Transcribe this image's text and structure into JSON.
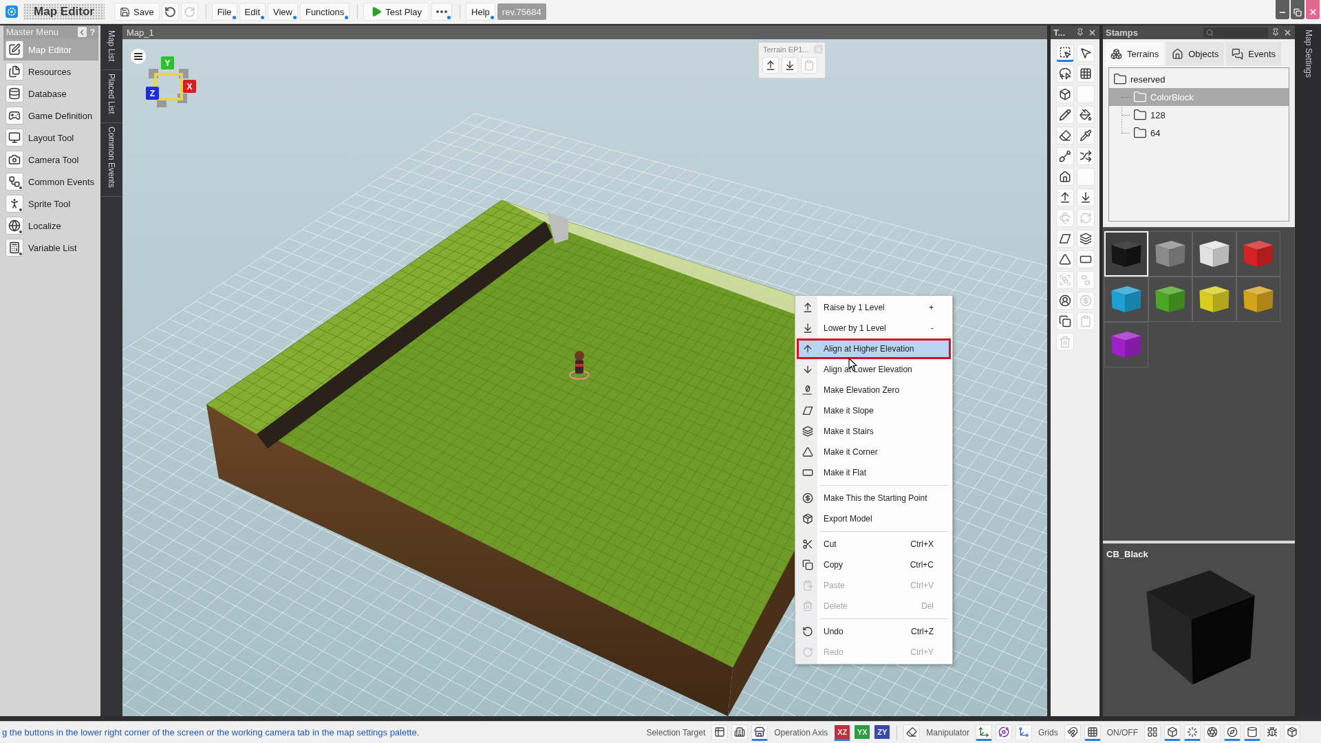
{
  "title_bar": {
    "app_title": "Map Editor",
    "save": "Save",
    "undo": {
      "disabled": false
    },
    "redo": {
      "disabled": true
    },
    "menus": [
      {
        "label": "File"
      },
      {
        "label": "Edit"
      },
      {
        "label": "View"
      },
      {
        "label": "Functions"
      }
    ],
    "test_play": "Test Play",
    "help": "Help",
    "revision": "rev.75684"
  },
  "master_menu": {
    "title": "Master Menu",
    "help_mark": "?",
    "items": [
      {
        "label": "Map Editor",
        "kind": "map-editor",
        "selected": true,
        "submenu": false
      },
      {
        "label": "Resources",
        "kind": "resources",
        "selected": false,
        "submenu": false
      },
      {
        "label": "Database",
        "kind": "database",
        "selected": false,
        "submenu": false
      },
      {
        "label": "Game Definition",
        "kind": "game-definition",
        "selected": false,
        "submenu": false
      },
      {
        "label": "Layout Tool",
        "kind": "layout-tool",
        "selected": false,
        "submenu": false
      },
      {
        "label": "Camera Tool",
        "kind": "camera-tool",
        "selected": false,
        "submenu": false
      },
      {
        "label": "Common Events",
        "kind": "common-events",
        "selected": false,
        "submenu": true
      },
      {
        "label": "Sprite Tool",
        "kind": "sprite-tool",
        "selected": false,
        "submenu": true
      },
      {
        "label": "Localize",
        "kind": "localize",
        "selected": false,
        "submenu": true
      },
      {
        "label": "Variable List",
        "kind": "variable-list",
        "selected": false,
        "submenu": true
      }
    ]
  },
  "side_tabs": [
    {
      "label": "Map List"
    },
    {
      "label": "Placed List"
    },
    {
      "label": "Common Events"
    }
  ],
  "map_view": {
    "title": "Map_1",
    "axes": [
      {
        "label": "Y",
        "color": "#2ec02e"
      },
      {
        "label": "X",
        "color": "#d61f1f"
      },
      {
        "label": "Z",
        "color": "#1f2fd6"
      }
    ],
    "terrain_popup": {
      "title": "Terrain EP1...",
      "buttons": [
        {
          "kind": "raise",
          "disabled": false
        },
        {
          "kind": "lower",
          "disabled": false
        },
        {
          "kind": "clipboard",
          "disabled": true
        }
      ]
    }
  },
  "context_menu": {
    "sections": [
      [
        {
          "label": "Raise by 1 Level",
          "shortcut": "+",
          "kind": "raise",
          "selected": false,
          "disabled": false
        },
        {
          "label": "Lower by 1 Level",
          "shortcut": "-",
          "kind": "lower",
          "selected": false,
          "disabled": false
        },
        {
          "label": "Align at Higher Elevation",
          "kind": "align-up",
          "selected": true,
          "disabled": false
        },
        {
          "label": "Align at Lower Elevation",
          "kind": "align-down",
          "selected": false,
          "disabled": false
        },
        {
          "label": "Make Elevation Zero",
          "kind": "zero",
          "selected": false,
          "disabled": false
        },
        {
          "label": "Make it Slope",
          "kind": "slope",
          "selected": false,
          "disabled": false
        },
        {
          "label": "Make it Stairs",
          "kind": "stairs",
          "selected": false,
          "disabled": false
        },
        {
          "label": "Make it Corner",
          "kind": "corner",
          "selected": false,
          "disabled": false
        },
        {
          "label": "Make it Flat",
          "kind": "flat",
          "selected": false,
          "disabled": false
        }
      ],
      [
        {
          "label": "Make This the Starting Point",
          "kind": "start-point",
          "selected": false,
          "disabled": false
        },
        {
          "label": "Export Model",
          "kind": "export",
          "selected": false,
          "disabled": false
        }
      ],
      [
        {
          "label": "Cut",
          "shortcut": "Ctrl+X",
          "kind": "cut",
          "selected": false,
          "disabled": false
        },
        {
          "label": "Copy",
          "shortcut": "Ctrl+C",
          "kind": "copy",
          "selected": false,
          "disabled": false
        },
        {
          "label": "Paste",
          "shortcut": "Ctrl+V",
          "kind": "paste",
          "selected": false,
          "disabled": true
        },
        {
          "label": "Delete",
          "shortcut": "Del",
          "kind": "trash",
          "selected": false,
          "disabled": true
        }
      ],
      [
        {
          "label": "Undo",
          "shortcut": "Ctrl+Z",
          "kind": "undo",
          "selected": false,
          "disabled": false
        },
        {
          "label": "Redo",
          "shortcut": "Ctrl+Y",
          "kind": "redo",
          "selected": false,
          "disabled": true
        }
      ]
    ]
  },
  "tool_palette": {
    "title": "T...",
    "tools": [
      {
        "kind": "dashed-select",
        "selected": true,
        "disabled": false
      },
      {
        "kind": "pointer",
        "selected": false,
        "disabled": false
      },
      {
        "kind": "lasso",
        "selected": false,
        "disabled": false
      },
      {
        "kind": "grid-select",
        "selected": false,
        "disabled": false
      },
      {
        "kind": "cube-select",
        "selected": false,
        "disabled": false
      },
      {
        "kind": "blank",
        "selected": false
      },
      {
        "kind": "pencil",
        "selected": false,
        "disabled": false
      },
      {
        "kind": "paint-bucket",
        "selected": false,
        "disabled": false
      },
      {
        "kind": "eraser",
        "selected": false,
        "disabled": false
      },
      {
        "kind": "pipette",
        "selected": false,
        "disabled": false
      },
      {
        "kind": "shovel",
        "selected": false,
        "disabled": false
      },
      {
        "kind": "shuffle",
        "selected": false,
        "disabled": false
      },
      {
        "kind": "house",
        "selected": false,
        "disabled": false
      },
      {
        "kind": "blank",
        "selected": false
      },
      {
        "kind": "raise",
        "selected": false,
        "disabled": false
      },
      {
        "kind": "lower",
        "selected": false,
        "disabled": false
      },
      {
        "kind": "rotate",
        "selected": false,
        "disabled": true
      },
      {
        "kind": "rotate-flip",
        "selected": false,
        "disabled": true
      },
      {
        "kind": "slope",
        "selected": false,
        "disabled": false
      },
      {
        "kind": "stairs",
        "selected": false,
        "disabled": false
      },
      {
        "kind": "corner",
        "selected": false,
        "disabled": false
      },
      {
        "kind": "flat",
        "selected": false,
        "disabled": false
      },
      {
        "kind": "group",
        "selected": false,
        "disabled": true
      },
      {
        "kind": "ungroup",
        "selected": false,
        "disabled": true
      },
      {
        "kind": "person-spot",
        "selected": false,
        "disabled": false
      },
      {
        "kind": "start-point",
        "selected": false,
        "disabled": true
      },
      {
        "kind": "copy",
        "selected": false,
        "disabled": false
      },
      {
        "kind": "clipboard",
        "selected": false,
        "disabled": true
      },
      {
        "kind": "trash",
        "selected": false,
        "disabled": true
      }
    ]
  },
  "stamps": {
    "title": "Stamps",
    "tabs": [
      {
        "label": "Terrains",
        "kind": "terrains",
        "selected": true
      },
      {
        "label": "Objects",
        "kind": "objects",
        "selected": false
      },
      {
        "label": "Events",
        "kind": "events",
        "selected": false
      }
    ],
    "tree": [
      {
        "label": "reserved",
        "selected": false,
        "expanded": true,
        "children": [
          {
            "label": "ColorBlock",
            "selected": true
          },
          {
            "label": "128",
            "selected": false
          },
          {
            "label": "64",
            "selected": false
          }
        ]
      }
    ],
    "swatches": [
      {
        "color": "#151515",
        "selected": true
      },
      {
        "color": "#8a8a8a",
        "selected": false
      },
      {
        "color": "#e2e2e2",
        "selected": false
      },
      {
        "color": "#d42222",
        "selected": false
      },
      {
        "color": "#1e9fd2",
        "selected": false
      },
      {
        "color": "#4aa524",
        "selected": false
      },
      {
        "color": "#d8cc1e",
        "selected": false
      },
      {
        "color": "#d4a31c",
        "selected": false
      },
      {
        "color": "#a020c8",
        "selected": false
      }
    ],
    "preview": {
      "title": "CB_Black"
    }
  },
  "map_settings_tab": {
    "label": "Map Settings"
  },
  "status_bar": {
    "hint": "g the buttons in the lower right corner of the screen or the working camera tab in the map settings palette.",
    "controls": [
      {
        "kind": "label",
        "text": "Selection Target"
      },
      {
        "kind": "table",
        "on": false
      },
      {
        "kind": "building",
        "on": false
      },
      {
        "kind": "store",
        "on": true
      },
      {
        "kind": "label",
        "text": "Operation Axis"
      },
      {
        "kind": "axis",
        "text": "XZ",
        "color": "#c0303c",
        "on": true
      },
      {
        "kind": "axis",
        "text": "YX",
        "color": "#2e9a44",
        "on": false
      },
      {
        "kind": "axis",
        "text": "ZY",
        "color": "#3a4aa8",
        "on": false
      },
      {
        "kind": "separator"
      },
      {
        "kind": "eraser",
        "on": false
      },
      {
        "kind": "label",
        "text": "Manipulator"
      },
      {
        "kind": "move-axes",
        "on": true
      },
      {
        "kind": "orbit",
        "on": false
      },
      {
        "kind": "scale",
        "on": false
      },
      {
        "kind": "label",
        "text": "Grids"
      },
      {
        "kind": "magnet",
        "on": false
      },
      {
        "kind": "grid",
        "on": true
      },
      {
        "kind": "label",
        "text": "ON/OFF"
      },
      {
        "kind": "tiles",
        "on": false
      },
      {
        "kind": "cube",
        "on": true
      },
      {
        "kind": "spinner",
        "on": true
      },
      {
        "kind": "aperture",
        "on": false
      },
      {
        "kind": "compass",
        "on": true
      },
      {
        "kind": "cylinder",
        "on": true
      },
      {
        "kind": "bug",
        "on": false
      },
      {
        "kind": "package",
        "on": false
      }
    ]
  }
}
